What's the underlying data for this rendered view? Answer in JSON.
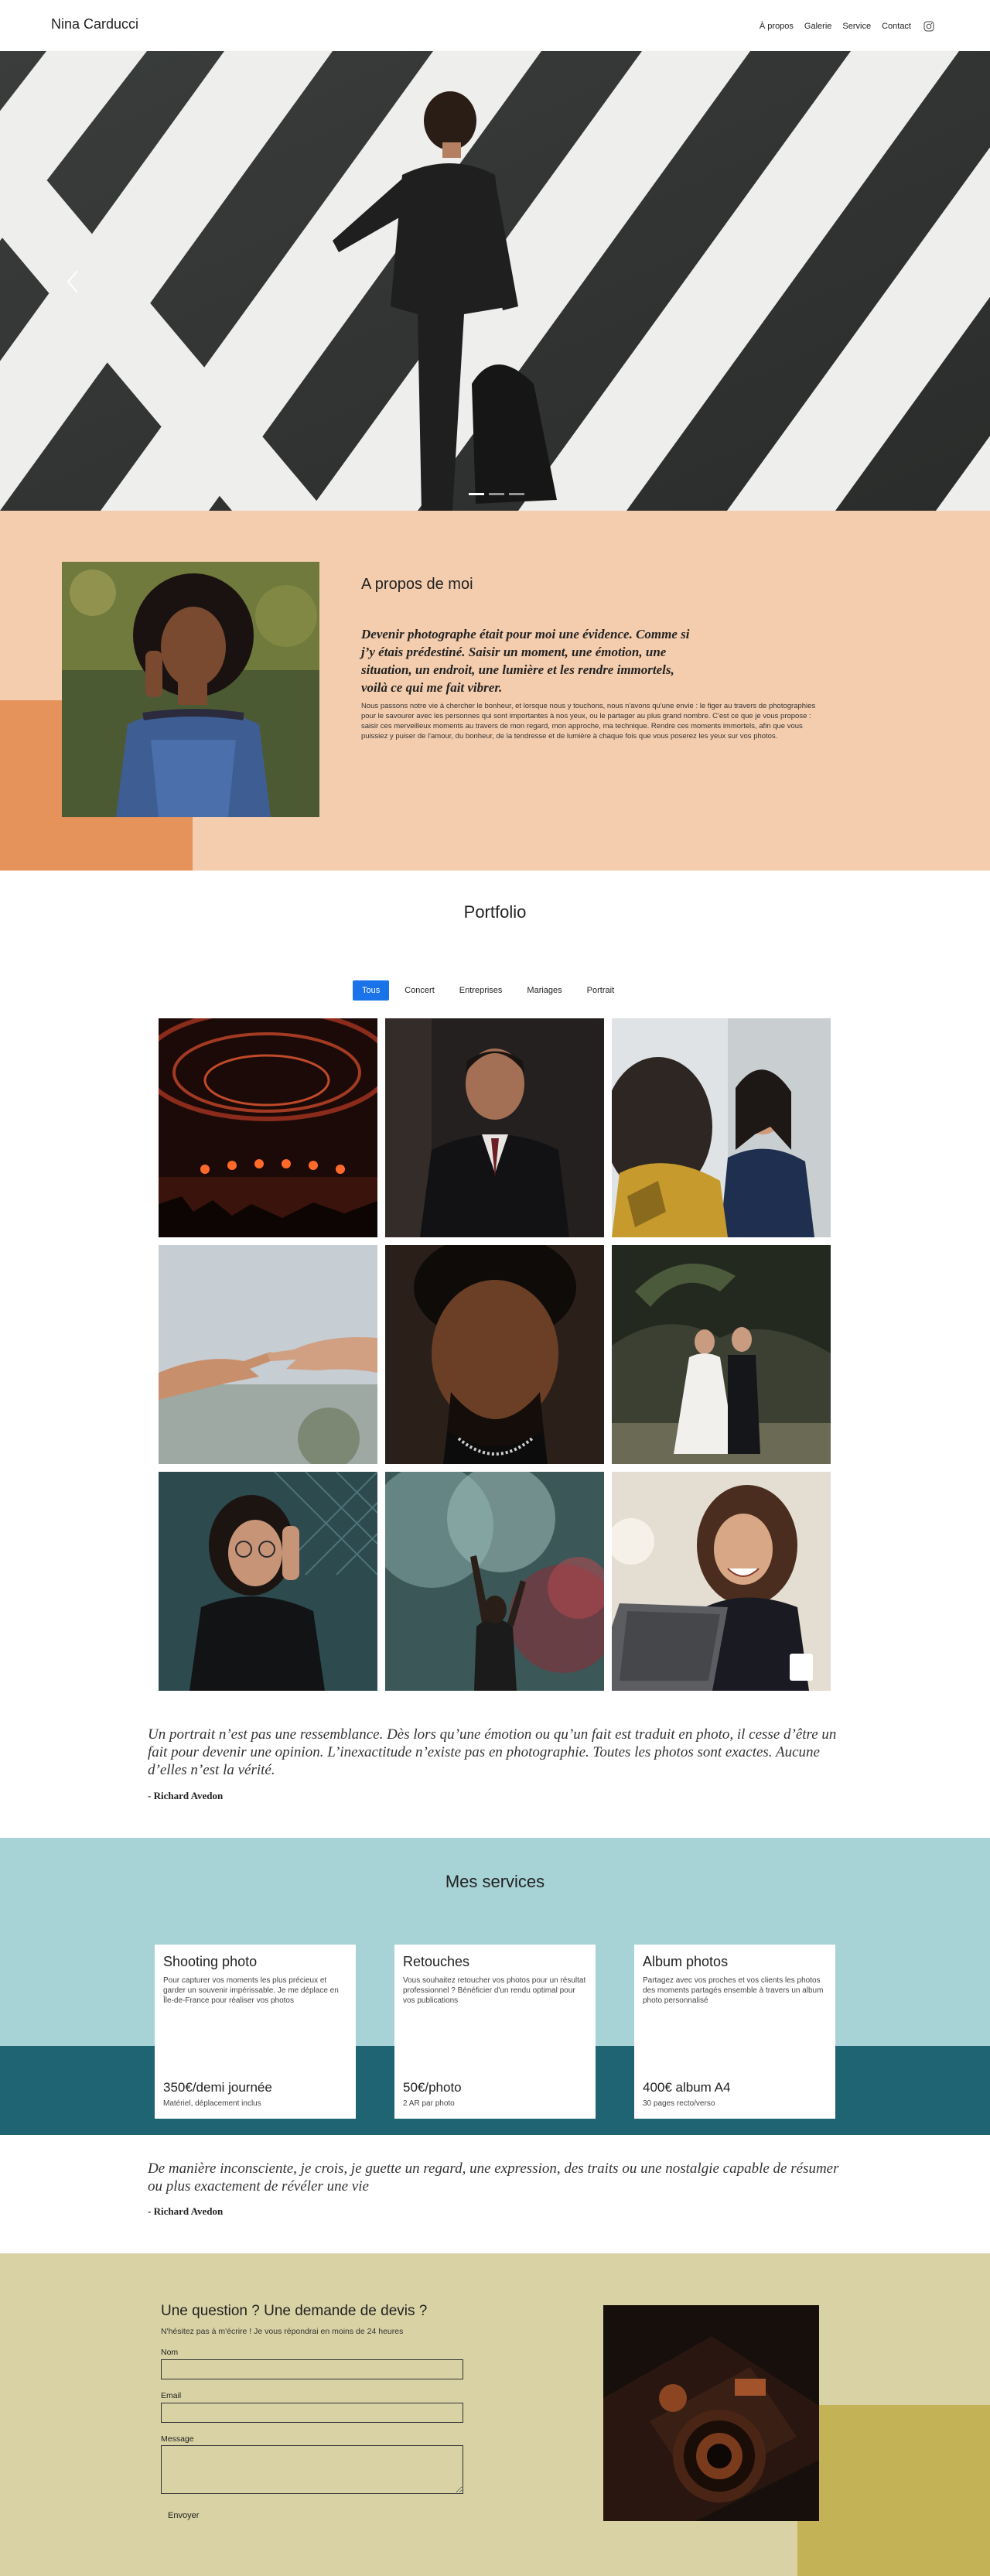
{
  "header": {
    "brand": "Nina Carducci",
    "nav": [
      "À propos",
      "Galerie",
      "Service",
      "Contact"
    ],
    "instagram_icon": "instagram-icon"
  },
  "hero": {
    "slide_count": 3,
    "active_slide": 1,
    "prev_icon": "chevron-left-icon"
  },
  "about": {
    "title": "A propos de moi",
    "quote": "Devenir photographe était pour moi une évidence. Comme si j’y étais prédestiné. Saisir un moment, une émotion, une situation, un endroit, une lumière et les rendre immortels, voilà ce qui me fait vibrer.",
    "body": "Nous passons notre vie à chercher le bonheur, et lorsque nous y touchons, nous n'avons qu'une envie : le figer au travers de photographies pour le savourer avec les personnes qui sont importantes à nos yeux, ou le partager au plus grand nombre. C'est ce que je vous propose : saisir ces merveilleux moments au travers de mon regard, mon approche, ma technique. Rendre ces moments immortels, afin que vous puissiez y puiser de l'amour, du bonheur, de la tendresse et de lumière à chaque fois que vous poserez les yeux sur vos photos.",
    "accent_color": "#e5925b",
    "bg_color": "#f4cdae"
  },
  "portfolio": {
    "title": "Portfolio",
    "filters": [
      "Tous",
      "Concert",
      "Entreprises",
      "Mariages",
      "Portrait"
    ],
    "active_filter": "Tous"
  },
  "quotes": [
    {
      "text": "Un portrait n’est pas une ressemblance. Dès lors qu’une émotion ou qu’un fait est traduit en photo, il cesse d’être un fait pour devenir une opinion. L’inexactitude n’existe pas en photographie. Toutes les photos sont exactes. Aucune d’elles n’est la vérité.",
      "author": "- Richard Avedon"
    },
    {
      "text": "De manière inconsciente, je crois, je guette un regard, une expression, des traits ou une nostalgie capable de résumer ou plus exactement de révéler une vie",
      "author": "- Richard Avedon"
    }
  ],
  "services": {
    "title": "Mes services",
    "bg_color": "#a7d3d6",
    "band_color": "#1e6473",
    "cards": [
      {
        "title": "Shooting photo",
        "desc": "Pour capturer vos moments les plus précieux et garder un souvenir impérissable. Je me déplace en Île-de-France pour réaliser vos photos",
        "price": "350€/demi journée",
        "note": "Matériel, déplacement inclus"
      },
      {
        "title": "Retouches",
        "desc": "Vous souhaitez retoucher vos photos pour un résultat professionnel ? Bénéficier d'un rendu optimal pour vos publications",
        "price": "50€/photo",
        "note": "2 AR par photo"
      },
      {
        "title": "Album photos",
        "desc": "Partagez avec vos proches et vos clients les photos des moments partagés ensemble à travers un album photo personnalisé",
        "price": "400€ album A4",
        "note": "30 pages recto/verso"
      }
    ]
  },
  "contact": {
    "title": "Une question ? Une demande de devis ?",
    "subtitle": "N'hésitez pas à m'écrire ! Je vous répondrai en moins de 24 heures",
    "name_label": "Nom",
    "email_label": "Email",
    "message_label": "Message",
    "submit": "Envoyer",
    "bg_color": "#d8d2a4",
    "accent_color": "#c4b356"
  }
}
